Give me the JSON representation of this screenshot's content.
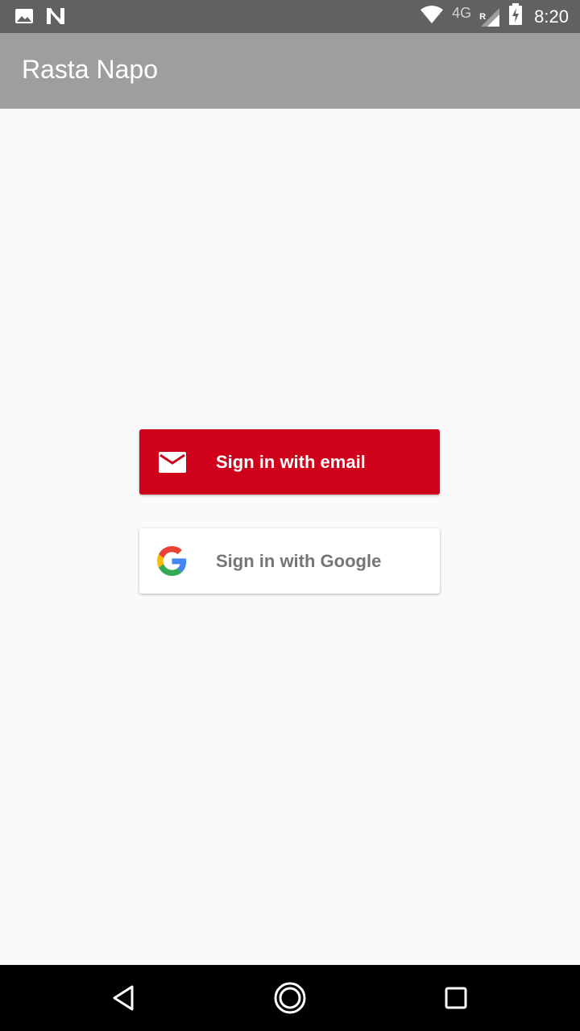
{
  "status_bar": {
    "network": "4G",
    "roaming": "R",
    "time": "8:20",
    "icons": [
      "image-icon",
      "n-icon",
      "wifi-icon",
      "signal-icon",
      "battery-charging-icon"
    ]
  },
  "app_bar": {
    "title": "Rasta Napo"
  },
  "auth": {
    "email_label": "Sign in with email",
    "google_label": "Sign in with Google"
  },
  "nav_bar": {
    "icons": [
      "back-icon",
      "home-icon",
      "recents-icon"
    ]
  },
  "colors": {
    "status_bar": "#616161",
    "app_bar": "#9e9e9e",
    "email_button": "#d0021b",
    "google_text": "#757575",
    "background": "#fafafa"
  }
}
